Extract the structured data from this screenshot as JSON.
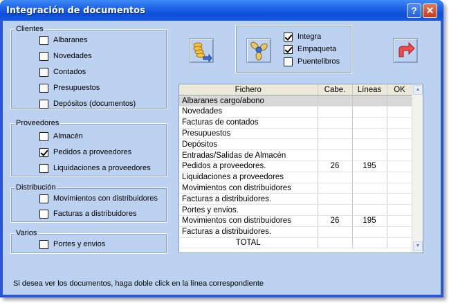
{
  "window": {
    "title": "Integración de documentos",
    "help_glyph": "?",
    "close_glyph": "✕"
  },
  "clientes": {
    "legend": "Clientes",
    "items": [
      {
        "label": "Albaranes",
        "checked": false
      },
      {
        "label": "Novedades",
        "checked": false
      },
      {
        "label": "Contados",
        "checked": false
      },
      {
        "label": "Presupuestos",
        "checked": false
      },
      {
        "label": "Depósitos (documentos)",
        "checked": false
      }
    ]
  },
  "proveedores": {
    "legend": "Proveedores",
    "items": [
      {
        "label": "Almacén",
        "checked": false
      },
      {
        "label": "Pedidos a proveedores",
        "checked": true
      },
      {
        "label": "Liquidaciones a proveedores",
        "checked": false
      }
    ]
  },
  "distribucion": {
    "legend": "Distribución",
    "items": [
      {
        "label": "Movimientos con distribuidores",
        "checked": false
      },
      {
        "label": "Facturas a distribuidores",
        "checked": false
      }
    ]
  },
  "varios": {
    "legend": "Varios",
    "items": [
      {
        "label": "Portes y envios",
        "checked": false
      }
    ]
  },
  "options": {
    "items": [
      {
        "label": "Integra",
        "checked": true
      },
      {
        "label": "Empaqueta",
        "checked": true
      },
      {
        "label": "Puentelibros",
        "checked": false
      }
    ]
  },
  "toolbar": {
    "integrate_icon": "coins-arrow-icon",
    "package_icon": "propeller-icon",
    "exit_icon": "red-arrow-icon"
  },
  "grid": {
    "headers": [
      "Fichero",
      "Cabe.",
      "Líneas",
      "OK"
    ],
    "rows": [
      {
        "fichero": "Albaranes cargo/abono",
        "cabe": "",
        "lineas": "",
        "ok": ""
      },
      {
        "fichero": "Novedades",
        "cabe": "",
        "lineas": "",
        "ok": ""
      },
      {
        "fichero": "Facturas de contados",
        "cabe": "",
        "lineas": "",
        "ok": ""
      },
      {
        "fichero": "Presupuestos",
        "cabe": "",
        "lineas": "",
        "ok": ""
      },
      {
        "fichero": "Depósitos",
        "cabe": "",
        "lineas": "",
        "ok": ""
      },
      {
        "fichero": "Entradas/Salidas de Almacén",
        "cabe": "",
        "lineas": "",
        "ok": ""
      },
      {
        "fichero": "Pedidos a proveedores.",
        "cabe": "26",
        "lineas": "195",
        "ok": ""
      },
      {
        "fichero": "Liquidaciones a proveedores",
        "cabe": "",
        "lineas": "",
        "ok": ""
      },
      {
        "fichero": "Movimientos con distribuidores",
        "cabe": "",
        "lineas": "",
        "ok": ""
      },
      {
        "fichero": "Facturas a distribuidores.",
        "cabe": "",
        "lineas": "",
        "ok": ""
      },
      {
        "fichero": "Portes y envios.",
        "cabe": "",
        "lineas": "",
        "ok": ""
      },
      {
        "fichero": "Movimientos con distribuidores",
        "cabe": "26",
        "lineas": "195",
        "ok": ""
      },
      {
        "fichero": "Facturas a distribuidores.",
        "cabe": "",
        "lineas": "",
        "ok": ""
      },
      {
        "fichero": "TOTAL",
        "cabe": "",
        "lineas": "",
        "ok": ""
      }
    ]
  },
  "hint": "Si desea ver los documentos, haga doble click en la línea correspondiente",
  "colors": {
    "titlebar": "#1f62e6",
    "client_bg": "#bcd2f0",
    "selected_row": "#d8d8d8"
  }
}
